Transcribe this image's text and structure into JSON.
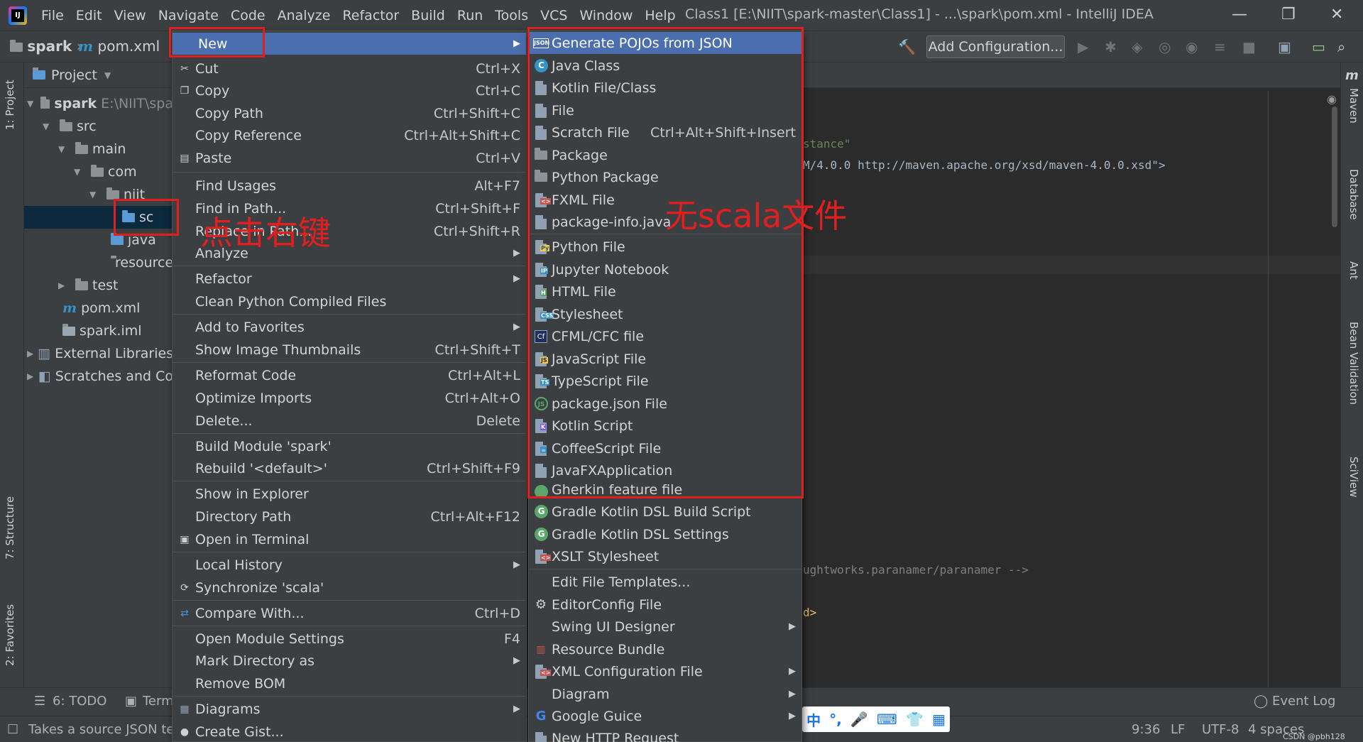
{
  "window": {
    "menu": [
      "File",
      "Edit",
      "View",
      "Navigate",
      "Code",
      "Analyze",
      "Refactor",
      "Build",
      "Run",
      "Tools",
      "VCS",
      "Window",
      "Help"
    ],
    "title": "Class1 [E:\\NIIT\\spark-master\\Class1] - ...\\spark\\pom.xml - IntelliJ IDEA"
  },
  "navbar": {
    "crumb_project": "spark",
    "crumb_file": "pom.xml",
    "add_configuration": "Add Configuration..."
  },
  "left_tabs": {
    "project": "1: Project",
    "structure": "7: Structure",
    "favorites": "2: Favorites"
  },
  "right_tabs": {
    "maven": "Maven",
    "database": "Database",
    "ant": "Ant",
    "bean": "Bean Validation",
    "sciview": "SciView"
  },
  "project_panel": {
    "header": "Project",
    "tree": [
      {
        "label": "spark",
        "extra": "E:\\NIIT\\spa"
      },
      {
        "label": "src",
        "extra": ""
      },
      {
        "label": "main",
        "extra": ""
      },
      {
        "label": "com",
        "extra": ""
      },
      {
        "label": "niit",
        "extra": ""
      },
      {
        "label": "sc",
        "extra": ""
      },
      {
        "label": "java",
        "extra": ""
      },
      {
        "label": "resource",
        "extra": ""
      },
      {
        "label": "test",
        "extra": ""
      },
      {
        "label": "pom.xml",
        "extra": ""
      },
      {
        "label": "spark.iml",
        "extra": ""
      },
      {
        "label": "External Libraries",
        "extra": ""
      },
      {
        "label": "Scratches and Co",
        "extra": ""
      }
    ]
  },
  "editor": {
    "lines": [
      "stance\"",
      "M/4.0.0 http://maven.apache.org/xsd/maven-4.0.0.xsd\">",
      "ughtworks.paranamer/paranamer -->",
      "d>"
    ]
  },
  "context_menu": {
    "items": [
      {
        "label": "New",
        "shortcut": ""
      },
      {
        "label": "Cut",
        "shortcut": "Ctrl+X"
      },
      {
        "label": "Copy",
        "shortcut": "Ctrl+C"
      },
      {
        "label": "Copy Path",
        "shortcut": "Ctrl+Shift+C"
      },
      {
        "label": "Copy Reference",
        "shortcut": "Ctrl+Alt+Shift+C"
      },
      {
        "label": "Paste",
        "shortcut": "Ctrl+V"
      },
      {
        "label": "Find Usages",
        "shortcut": "Alt+F7"
      },
      {
        "label": "Find in Path...",
        "shortcut": "Ctrl+Shift+F"
      },
      {
        "label": "Replace in Path...",
        "shortcut": "Ctrl+Shift+R"
      },
      {
        "label": "Analyze",
        "shortcut": ""
      },
      {
        "label": "Refactor",
        "shortcut": ""
      },
      {
        "label": "Clean Python Compiled Files",
        "shortcut": ""
      },
      {
        "label": "Add to Favorites",
        "shortcut": ""
      },
      {
        "label": "Show Image Thumbnails",
        "shortcut": "Ctrl+Shift+T"
      },
      {
        "label": "Reformat Code",
        "shortcut": "Ctrl+Alt+L"
      },
      {
        "label": "Optimize Imports",
        "shortcut": "Ctrl+Alt+O"
      },
      {
        "label": "Delete...",
        "shortcut": "Delete"
      },
      {
        "label": "Build Module 'spark'",
        "shortcut": ""
      },
      {
        "label": "Rebuild '<default>'",
        "shortcut": "Ctrl+Shift+F9"
      },
      {
        "label": "Show in Explorer",
        "shortcut": ""
      },
      {
        "label": "Directory Path",
        "shortcut": "Ctrl+Alt+F12"
      },
      {
        "label": "Open in Terminal",
        "shortcut": ""
      },
      {
        "label": "Local History",
        "shortcut": ""
      },
      {
        "label": "Synchronize 'scala'",
        "shortcut": ""
      },
      {
        "label": "Compare With...",
        "shortcut": "Ctrl+D"
      },
      {
        "label": "Open Module Settings",
        "shortcut": "F4"
      },
      {
        "label": "Mark Directory as",
        "shortcut": ""
      },
      {
        "label": "Remove BOM",
        "shortcut": ""
      },
      {
        "label": "Diagrams",
        "shortcut": ""
      },
      {
        "label": "Create Gist...",
        "shortcut": ""
      }
    ]
  },
  "new_submenu": {
    "items": [
      {
        "label": "Generate POJOs from JSON",
        "shortcut": "",
        "icon": "json-icon"
      },
      {
        "label": "Java Class",
        "shortcut": "",
        "icon": "class-icon"
      },
      {
        "label": "Kotlin File/Class",
        "shortcut": "",
        "icon": "kotlin-icon"
      },
      {
        "label": "File",
        "shortcut": "",
        "icon": "file-icon"
      },
      {
        "label": "Scratch File",
        "shortcut": "Ctrl+Alt+Shift+Insert",
        "icon": "scratch-icon"
      },
      {
        "label": "Package",
        "shortcut": "",
        "icon": "package-icon"
      },
      {
        "label": "Python Package",
        "shortcut": "",
        "icon": "package-icon"
      },
      {
        "label": "FXML File",
        "shortcut": "",
        "icon": "fxml-icon"
      },
      {
        "label": "package-info.java",
        "shortcut": "",
        "icon": "java-file-icon"
      },
      {
        "label": "Python File",
        "shortcut": "",
        "icon": "python-icon"
      },
      {
        "label": "Jupyter Notebook",
        "shortcut": "",
        "icon": "jupyter-icon"
      },
      {
        "label": "HTML File",
        "shortcut": "",
        "icon": "html-icon"
      },
      {
        "label": "Stylesheet",
        "shortcut": "",
        "icon": "css-icon"
      },
      {
        "label": "CFML/CFC file",
        "shortcut": "",
        "icon": "cfml-icon"
      },
      {
        "label": "JavaScript File",
        "shortcut": "",
        "icon": "js-icon"
      },
      {
        "label": "TypeScript File",
        "shortcut": "",
        "icon": "ts-icon"
      },
      {
        "label": "package.json File",
        "shortcut": "",
        "icon": "nodejs-icon"
      },
      {
        "label": "Kotlin Script",
        "shortcut": "",
        "icon": "kotlin-script-icon"
      },
      {
        "label": "CoffeeScript File",
        "shortcut": "",
        "icon": "coffee-icon"
      },
      {
        "label": "JavaFXApplication",
        "shortcut": "",
        "icon": "javafx-icon"
      },
      {
        "label": "Gherkin feature file",
        "shortcut": "",
        "icon": "gherkin-icon"
      },
      {
        "label": "Gradle Kotlin DSL Build Script",
        "shortcut": "",
        "icon": "gradle-icon"
      },
      {
        "label": "Gradle Kotlin DSL Settings",
        "shortcut": "",
        "icon": "gradle-icon"
      },
      {
        "label": "XSLT Stylesheet",
        "shortcut": "",
        "icon": "xslt-icon"
      },
      {
        "label": "Edit File Templates...",
        "shortcut": "",
        "icon": ""
      },
      {
        "label": "EditorConfig File",
        "shortcut": "",
        "icon": "gear-icon"
      },
      {
        "label": "Swing UI Designer",
        "shortcut": "",
        "icon": ""
      },
      {
        "label": "Resource Bundle",
        "shortcut": "",
        "icon": "bundle-icon"
      },
      {
        "label": "XML Configuration File",
        "shortcut": "",
        "icon": "xml-icon"
      },
      {
        "label": "Diagram",
        "shortcut": "",
        "icon": ""
      },
      {
        "label": "Google Guice",
        "shortcut": "",
        "icon": "google-icon"
      },
      {
        "label": "New HTTP Request",
        "shortcut": "",
        "icon": "http-icon"
      }
    ]
  },
  "annotations": {
    "right_click": "点击右键",
    "no_scala": "无scala文件",
    "color": "#e02020"
  },
  "bottom": {
    "todo": "6: TODO",
    "terminal": "Term",
    "event_log": "Event Log",
    "status_text": "Takes a source JSON te",
    "position": "9:36",
    "line_sep": "LF",
    "encoding": "UTF-8",
    "indent": "4 spaces",
    "watermark": "CSDN @pbh128",
    "ime": [
      "中",
      "°,",
      "🎤",
      "⌨",
      "👕",
      "▦"
    ]
  }
}
